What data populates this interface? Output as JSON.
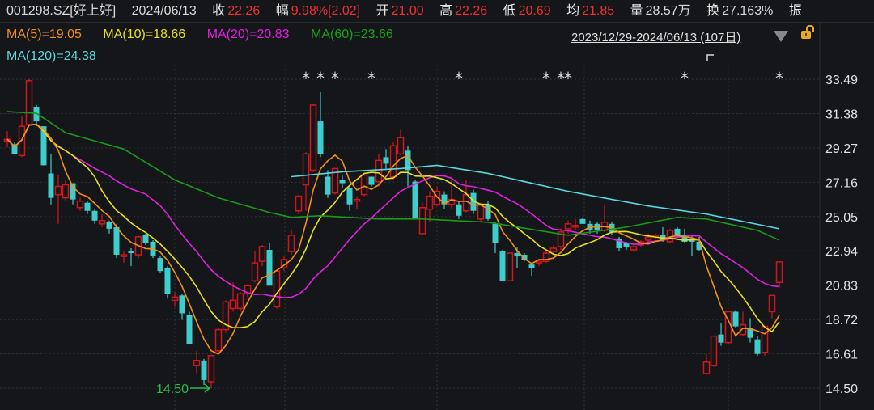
{
  "header": {
    "code": "001298.SZ[好上好]",
    "date": "2024/06/13",
    "close_label": "收",
    "close": "22.26",
    "change_label": "幅",
    "change": "9.98%[2.02]",
    "open_label": "开",
    "open": "21.00",
    "high_label": "高",
    "high": "22.26",
    "low_label": "低",
    "low": "20.69",
    "avg_label": "均",
    "avg": "21.85",
    "vol_label": "量",
    "vol": "28.57万",
    "turnover_label": "换",
    "turnover": "27.163%",
    "amp_label": "振"
  },
  "legend": {
    "ma5": "MA(5)=19.05",
    "ma10": "MA(10)=18.66",
    "ma20": "MA(20)=20.83",
    "ma60": "MA(60)=23.66",
    "ma120": "MA(120)=24.38"
  },
  "range_label": "2023/12/29-2024/06/13 (107日)",
  "colors": {
    "up": "#d4161c",
    "down": "#3ecdcd",
    "ma5": "#f0901a",
    "ma10": "#e8e020",
    "ma20": "#e020e0",
    "ma60": "#1a9a1a",
    "ma120": "#5ad8e0",
    "background": "#141619"
  },
  "chart_data": {
    "type": "candlestick",
    "ylim": [
      14.5,
      33.49
    ],
    "y_ticks": [
      "33.49",
      "31.38",
      "29.27",
      "27.16",
      "25.05",
      "22.94",
      "20.83",
      "18.72",
      "16.61",
      "14.50"
    ],
    "grid": true,
    "low_annotation": {
      "label": "14.50",
      "index": 28
    },
    "marker_symbol": "*",
    "marker_indices": [
      41,
      43,
      45,
      50,
      62,
      74,
      76,
      77,
      93,
      106
    ],
    "candles_ohlc": [
      [
        29.7,
        30.3,
        29.3,
        29.8
      ],
      [
        29.5,
        29.6,
        28.9,
        28.9
      ],
      [
        28.8,
        31.2,
        28.7,
        30.6
      ],
      [
        30.7,
        33.5,
        30.6,
        33.4
      ],
      [
        31.8,
        31.9,
        30.6,
        30.9
      ],
      [
        30.6,
        30.6,
        28.2,
        28.2
      ],
      [
        27.7,
        28.9,
        25.8,
        26.2
      ],
      [
        26.4,
        27.6,
        24.6,
        26.9
      ],
      [
        26.2,
        27.3,
        26.0,
        27.0
      ],
      [
        27.1,
        27.1,
        25.8,
        26.1
      ],
      [
        25.6,
        26.2,
        25.4,
        26.0
      ],
      [
        25.9,
        26.0,
        25.2,
        25.4
      ],
      [
        25.4,
        25.5,
        24.6,
        24.8
      ],
      [
        24.6,
        25.2,
        24.4,
        24.8
      ],
      [
        24.7,
        24.8,
        24.0,
        24.3
      ],
      [
        24.4,
        24.6,
        22.5,
        22.7
      ],
      [
        22.6,
        22.9,
        22.2,
        22.7
      ],
      [
        22.9,
        23.1,
        22.0,
        22.8
      ],
      [
        22.7,
        23.9,
        22.5,
        23.8
      ],
      [
        23.9,
        24.0,
        23.3,
        23.4
      ],
      [
        23.5,
        23.6,
        22.5,
        22.6
      ],
      [
        22.5,
        22.6,
        21.6,
        21.7
      ],
      [
        21.9,
        22.0,
        20.0,
        20.3
      ],
      [
        19.9,
        20.4,
        19.5,
        20.1
      ],
      [
        20.2,
        20.3,
        18.7,
        19.1
      ],
      [
        19.0,
        19.2,
        17.2,
        17.2
      ],
      [
        15.9,
        16.8,
        15.4,
        16.2
      ],
      [
        16.2,
        16.3,
        14.7,
        15.0
      ],
      [
        14.9,
        16.5,
        14.5,
        16.5
      ],
      [
        16.8,
        18.2,
        16.6,
        18.1
      ],
      [
        18.1,
        19.9,
        17.9,
        19.8
      ],
      [
        19.4,
        21.0,
        19.2,
        19.9
      ],
      [
        19.4,
        20.4,
        19.2,
        20.3
      ],
      [
        20.3,
        20.9,
        20.1,
        20.8
      ],
      [
        21.1,
        22.9,
        21.0,
        22.2
      ],
      [
        22.3,
        23.3,
        22.0,
        23.2
      ],
      [
        23.0,
        23.4,
        20.8,
        20.8
      ],
      [
        19.5,
        21.8,
        19.4,
        21.7
      ],
      [
        21.9,
        22.6,
        21.7,
        22.4
      ],
      [
        22.9,
        24.2,
        22.7,
        23.9
      ],
      [
        25.4,
        26.4,
        25.2,
        26.3
      ],
      [
        27.0,
        29.0,
        25.4,
        28.9
      ],
      [
        27.9,
        32.0,
        27.8,
        31.9
      ],
      [
        30.9,
        32.7,
        28.7,
        28.9
      ],
      [
        27.5,
        27.9,
        26.2,
        26.4
      ],
      [
        26.5,
        28.0,
        26.4,
        28.0
      ],
      [
        27.3,
        27.6,
        26.8,
        27.1
      ],
      [
        26.8,
        27.0,
        25.4,
        25.8
      ],
      [
        26.0,
        26.3,
        25.5,
        26.1
      ],
      [
        26.4,
        27.7,
        26.3,
        27.6
      ],
      [
        27.5,
        27.5,
        26.9,
        27.0
      ],
      [
        27.2,
        28.9,
        26.9,
        28.5
      ],
      [
        28.7,
        29.2,
        28.0,
        28.3
      ],
      [
        27.5,
        29.6,
        27.3,
        29.4
      ],
      [
        28.9,
        30.4,
        28.8,
        29.9
      ],
      [
        29.1,
        29.4,
        26.9,
        27.9
      ],
      [
        27.2,
        27.3,
        24.9,
        24.9
      ],
      [
        24.0,
        25.9,
        24.0,
        25.6
      ],
      [
        25.5,
        26.6,
        24.7,
        26.3
      ],
      [
        25.8,
        26.9,
        25.7,
        26.6
      ],
      [
        26.4,
        26.6,
        25.5,
        25.8
      ],
      [
        25.8,
        27.3,
        25.5,
        26.1
      ],
      [
        25.8,
        26.0,
        24.9,
        25.1
      ],
      [
        25.4,
        27.3,
        25.3,
        26.4
      ],
      [
        26.5,
        26.7,
        25.2,
        25.4
      ],
      [
        24.9,
        25.9,
        24.7,
        25.8
      ],
      [
        25.8,
        26.0,
        24.8,
        24.9
      ],
      [
        24.6,
        24.7,
        22.8,
        23.4
      ],
      [
        22.9,
        23.0,
        21.1,
        21.1
      ],
      [
        21.1,
        22.8,
        21.1,
        22.8
      ],
      [
        22.8,
        23.2,
        21.9,
        22.6
      ],
      [
        22.7,
        22.8,
        22.3,
        22.4
      ],
      [
        22.1,
        22.2,
        21.4,
        21.9
      ],
      [
        22.2,
        22.4,
        22.0,
        22.3
      ],
      [
        22.3,
        23.0,
        22.2,
        22.8
      ],
      [
        22.9,
        23.3,
        22.8,
        23.1
      ],
      [
        23.2,
        24.3,
        23.0,
        24.1
      ],
      [
        24.3,
        24.8,
        24.0,
        24.6
      ],
      [
        24.4,
        24.9,
        24.2,
        24.5
      ],
      [
        24.9,
        25.0,
        24.6,
        24.6
      ],
      [
        24.6,
        24.8,
        24.0,
        24.2
      ],
      [
        24.6,
        24.7,
        24.0,
        24.2
      ],
      [
        24.2,
        25.8,
        24.1,
        24.7
      ],
      [
        24.6,
        24.7,
        23.9,
        24.1
      ],
      [
        23.7,
        23.8,
        22.9,
        23.1
      ],
      [
        23.4,
        23.5,
        23.0,
        23.2
      ],
      [
        23.0,
        23.3,
        22.9,
        23.2
      ],
      [
        23.3,
        23.6,
        23.2,
        23.5
      ],
      [
        23.6,
        24.0,
        23.5,
        23.8
      ],
      [
        23.8,
        24.0,
        23.7,
        23.9
      ],
      [
        23.9,
        24.4,
        23.5,
        23.6
      ],
      [
        23.5,
        24.3,
        23.4,
        24.2
      ],
      [
        24.3,
        24.4,
        23.8,
        23.9
      ],
      [
        23.9,
        24.3,
        23.4,
        23.5
      ],
      [
        23.6,
        23.9,
        22.6,
        23.5
      ],
      [
        23.5,
        23.8,
        22.9,
        23.0
      ],
      [
        15.4,
        16.6,
        15.3,
        16.1
      ],
      [
        15.9,
        17.7,
        15.8,
        17.7
      ],
      [
        17.8,
        18.5,
        17.1,
        17.3
      ],
      [
        17.3,
        19.2,
        17.2,
        19.2
      ],
      [
        19.2,
        19.3,
        18.2,
        18.3
      ],
      [
        17.8,
        19.2,
        17.7,
        18.4
      ],
      [
        18.2,
        18.8,
        17.3,
        17.6
      ],
      [
        17.5,
        17.7,
        16.5,
        16.6
      ],
      [
        16.7,
        18.3,
        16.5,
        18.3
      ],
      [
        19.2,
        20.2,
        18.8,
        20.2
      ],
      [
        21.0,
        22.26,
        20.69,
        22.26
      ]
    ],
    "ma60_points": [
      [
        0,
        31.5
      ],
      [
        4,
        31.4
      ],
      [
        8,
        30.2
      ],
      [
        16,
        29.2
      ],
      [
        23,
        27.3
      ],
      [
        29,
        26.2
      ],
      [
        36,
        25.3
      ],
      [
        39,
        25.0
      ],
      [
        43,
        25.1
      ],
      [
        51,
        24.9
      ],
      [
        57,
        24.9
      ],
      [
        66,
        24.7
      ],
      [
        77,
        23.9
      ],
      [
        85,
        24.4
      ],
      [
        92,
        25.0
      ],
      [
        96,
        24.9
      ],
      [
        103,
        24.2
      ],
      [
        106,
        23.6
      ]
    ],
    "ma120_points": [
      [
        39,
        27.5
      ],
      [
        46,
        27.8
      ],
      [
        54,
        28.0
      ],
      [
        59,
        28.2
      ],
      [
        66,
        27.7
      ],
      [
        77,
        26.6
      ],
      [
        88,
        25.7
      ],
      [
        96,
        25.2
      ],
      [
        106,
        24.3
      ]
    ]
  }
}
